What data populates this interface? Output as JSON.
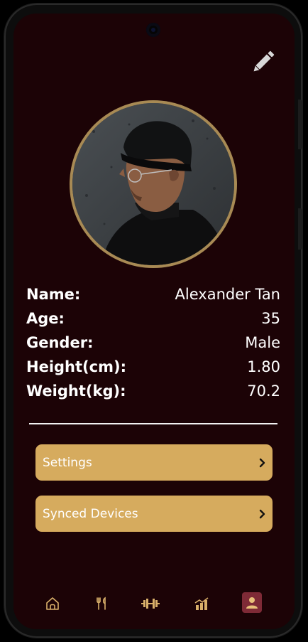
{
  "profile": {
    "name_label": "Name:",
    "name": "Alexander Tan",
    "age_label": "Age:",
    "age": "35",
    "gender_label": "Gender:",
    "gender": "Male",
    "height_label": "Height(cm):",
    "height": "1.80",
    "weight_label": "Weight(kg):",
    "weight": "70.2"
  },
  "menu": {
    "settings_label": "Settings",
    "synced_devices_label": "Synced Devices"
  },
  "icons": {
    "edit": "pencil-icon",
    "nav": [
      "home-icon",
      "fork-knife-icon",
      "dumbbell-icon",
      "chart-icon",
      "person-icon"
    ],
    "chevron": "chevron-right-icon"
  },
  "colors": {
    "background": "#1c0306",
    "accent_gold": "#d6ab5e",
    "ring_gold": "#a88a54",
    "nav_active": "#7e2a36",
    "nav_icon": "#d9b06a"
  },
  "nav": {
    "active_index": 4
  }
}
